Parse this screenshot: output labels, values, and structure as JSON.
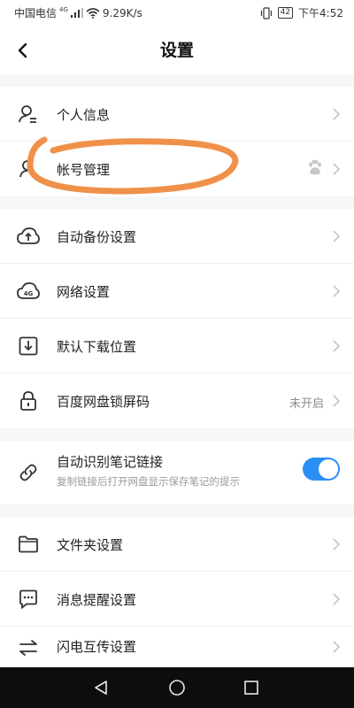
{
  "status": {
    "carrier": "中国电信",
    "network_type": "4G",
    "speed": "9.29K/s",
    "battery": "42",
    "time": "下午4:52"
  },
  "header": {
    "title": "设置"
  },
  "items": [
    {
      "label": "个人信息",
      "icon": "person-icon"
    },
    {
      "label": "帐号管理",
      "icon": "account-icon",
      "badge_icon": "baidu-paw-icon"
    },
    {
      "label": "自动备份设置",
      "icon": "cloud-upload-icon"
    },
    {
      "label": "网络设置",
      "icon": "cloud-4g-icon",
      "icon_text": "4G"
    },
    {
      "label": "默认下载位置",
      "icon": "download-icon"
    },
    {
      "label": "百度网盘锁屏码",
      "icon": "lock-icon",
      "value": "未开启"
    },
    {
      "label": "自动识别笔记链接",
      "icon": "link-icon",
      "sub": "复制链接后打开网盘显示保存笔记的提示",
      "toggle_on": true
    },
    {
      "label": "文件夹设置",
      "icon": "folder-icon"
    },
    {
      "label": "消息提醒设置",
      "icon": "message-icon"
    },
    {
      "label": "闪电互传设置",
      "icon": "transfer-icon"
    }
  ],
  "colors": {
    "accent": "#2b8ef5",
    "annotation": "#f0914a"
  }
}
